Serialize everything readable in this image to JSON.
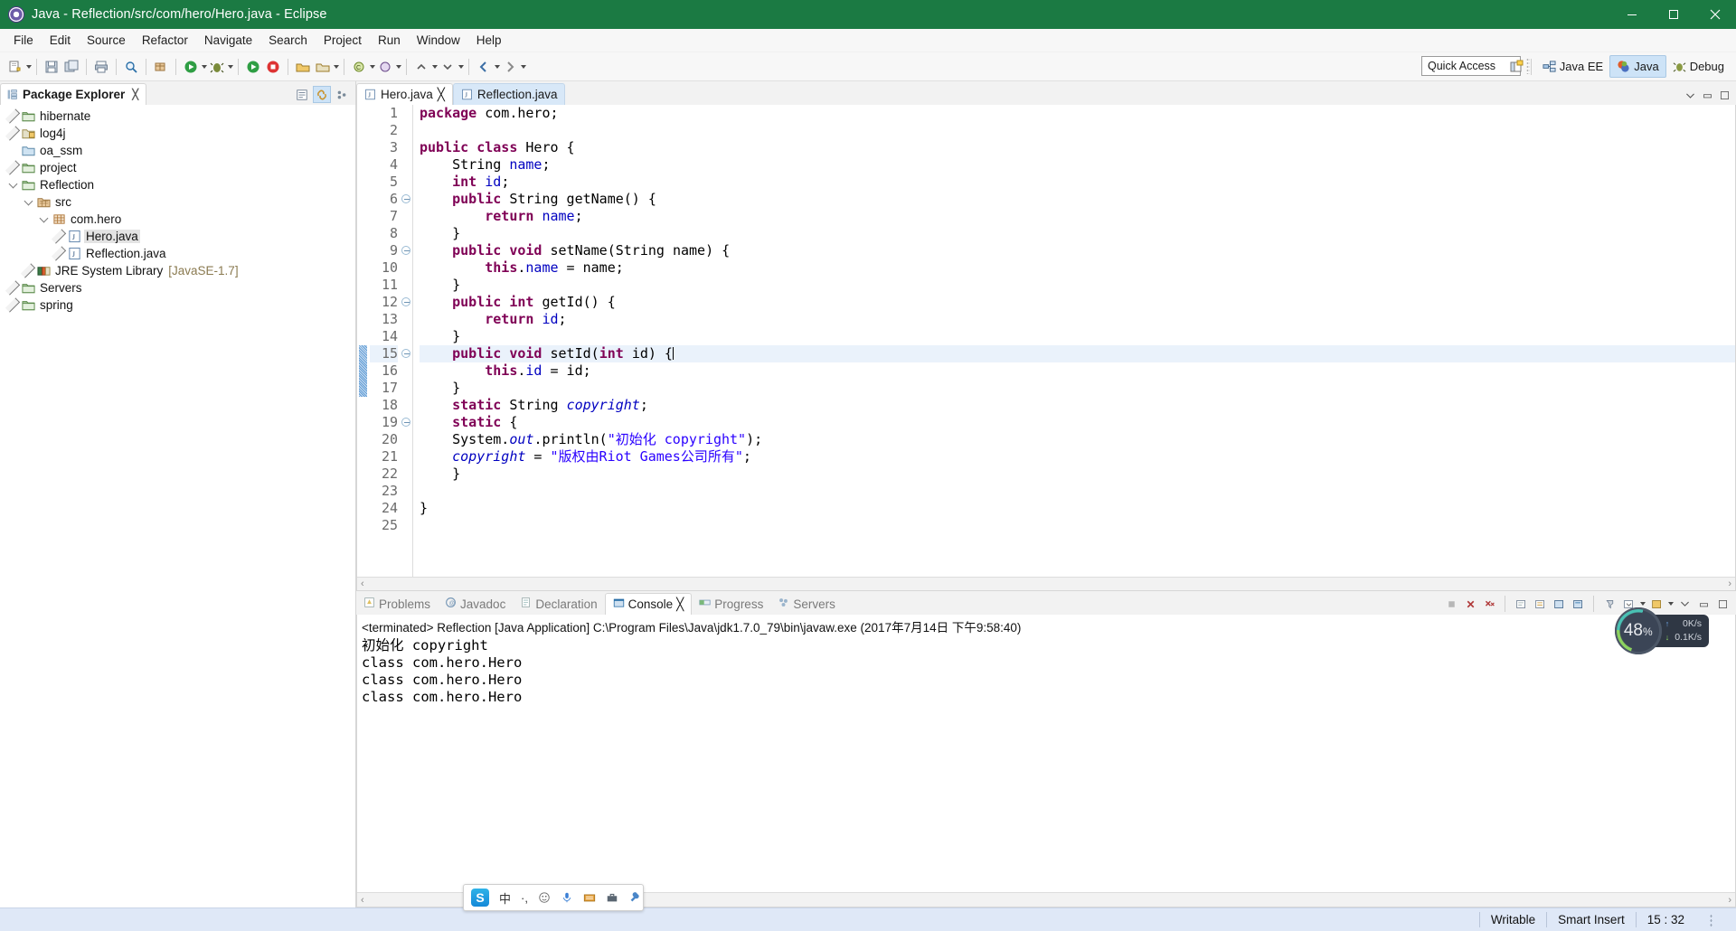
{
  "window": {
    "title": "Java - Reflection/src/com/hero/Hero.java - Eclipse",
    "app_icon": "eclipse-icon",
    "minimize": "–",
    "maximize": "❐",
    "close": "✕"
  },
  "menubar": {
    "items": [
      "File",
      "Edit",
      "Source",
      "Refactor",
      "Navigate",
      "Search",
      "Project",
      "Run",
      "Window",
      "Help"
    ]
  },
  "toolbar": {
    "quick_access_placeholder": "Quick Access",
    "quick_access_value": "Quick Access",
    "perspectives": [
      {
        "label": "Java EE",
        "icon": "java-ee-perspective-icon",
        "active": false
      },
      {
        "label": "Java",
        "icon": "java-perspective-icon",
        "active": true
      },
      {
        "label": "Debug",
        "icon": "debug-perspective-icon",
        "active": false
      }
    ],
    "open_perspective_icon": "open-perspective-icon"
  },
  "package_explorer": {
    "title": "Package Explorer",
    "close_glyph": "╳",
    "actions": [
      "collapse-all-icon",
      "link-with-editor-icon",
      "view-menu-icon"
    ],
    "tree": [
      {
        "label": "hibernate",
        "indent": 0,
        "twisty": "right",
        "icon": "project-folder-icon",
        "selected": false,
        "suffix": ""
      },
      {
        "label": "log4j",
        "indent": 0,
        "twisty": "right",
        "icon": "project-closed-icon",
        "selected": false,
        "suffix": ""
      },
      {
        "label": "oa_ssm",
        "indent": 0,
        "twisty": "none",
        "icon": "plain-folder-icon",
        "selected": false,
        "suffix": ""
      },
      {
        "label": "project",
        "indent": 0,
        "twisty": "right",
        "icon": "project-folder-icon",
        "selected": false,
        "suffix": ""
      },
      {
        "label": "Reflection",
        "indent": 0,
        "twisty": "down",
        "icon": "project-folder-icon",
        "selected": false,
        "suffix": ""
      },
      {
        "label": "src",
        "indent": 1,
        "twisty": "down",
        "icon": "source-folder-icon",
        "selected": false,
        "suffix": ""
      },
      {
        "label": "com.hero",
        "indent": 2,
        "twisty": "down",
        "icon": "package-icon",
        "selected": false,
        "suffix": ""
      },
      {
        "label": "Hero.java",
        "indent": 3,
        "twisty": "right",
        "icon": "java-file-icon",
        "selected": true,
        "suffix": ""
      },
      {
        "label": "Reflection.java",
        "indent": 3,
        "twisty": "right",
        "icon": "java-file-icon",
        "selected": false,
        "suffix": ""
      },
      {
        "label": "JRE System Library",
        "indent": 1,
        "twisty": "right",
        "icon": "jre-library-icon",
        "selected": false,
        "suffix": "[JavaSE-1.7]"
      },
      {
        "label": "Servers",
        "indent": 0,
        "twisty": "right",
        "icon": "project-folder-icon",
        "selected": false,
        "suffix": ""
      },
      {
        "label": "spring",
        "indent": 0,
        "twisty": "right",
        "icon": "project-folder-icon",
        "selected": false,
        "suffix": ""
      }
    ]
  },
  "editor": {
    "tabs": [
      {
        "label": "Hero.java",
        "icon": "java-file-icon",
        "active": true,
        "close_glyph": "╳"
      },
      {
        "label": "Reflection.java",
        "icon": "java-file-icon",
        "active": false,
        "close_glyph": ""
      }
    ],
    "highlight_line": 15,
    "fold_lines": [
      6,
      9,
      12,
      15,
      19
    ],
    "selection_bar_lines": [
      15,
      16,
      17
    ],
    "lines": [
      {
        "n": 1,
        "tokens": [
          {
            "t": "package ",
            "c": "kw"
          },
          {
            "t": "com.hero;",
            "c": ""
          }
        ]
      },
      {
        "n": 2,
        "tokens": []
      },
      {
        "n": 3,
        "tokens": [
          {
            "t": "public class ",
            "c": "kw"
          },
          {
            "t": "Hero {",
            "c": ""
          }
        ]
      },
      {
        "n": 4,
        "tokens": [
          {
            "t": "    String ",
            "c": ""
          },
          {
            "t": "name",
            "c": "fld"
          },
          {
            "t": ";",
            "c": ""
          }
        ]
      },
      {
        "n": 5,
        "tokens": [
          {
            "t": "    ",
            "c": ""
          },
          {
            "t": "int ",
            "c": "kw"
          },
          {
            "t": "id",
            "c": "fld"
          },
          {
            "t": ";",
            "c": ""
          }
        ]
      },
      {
        "n": 6,
        "tokens": [
          {
            "t": "    ",
            "c": ""
          },
          {
            "t": "public ",
            "c": "kw"
          },
          {
            "t": "String getName() {",
            "c": ""
          }
        ]
      },
      {
        "n": 7,
        "tokens": [
          {
            "t": "        ",
            "c": ""
          },
          {
            "t": "return ",
            "c": "kw"
          },
          {
            "t": "name",
            "c": "fld"
          },
          {
            "t": ";",
            "c": ""
          }
        ]
      },
      {
        "n": 8,
        "tokens": [
          {
            "t": "    }",
            "c": ""
          }
        ]
      },
      {
        "n": 9,
        "tokens": [
          {
            "t": "    ",
            "c": ""
          },
          {
            "t": "public void ",
            "c": "kw"
          },
          {
            "t": "setName(String name) {",
            "c": ""
          }
        ]
      },
      {
        "n": 10,
        "tokens": [
          {
            "t": "        ",
            "c": ""
          },
          {
            "t": "this",
            "c": "kw"
          },
          {
            "t": ".",
            "c": ""
          },
          {
            "t": "name",
            "c": "fld"
          },
          {
            "t": " = name;",
            "c": ""
          }
        ]
      },
      {
        "n": 11,
        "tokens": [
          {
            "t": "    }",
            "c": ""
          }
        ]
      },
      {
        "n": 12,
        "tokens": [
          {
            "t": "    ",
            "c": ""
          },
          {
            "t": "public int ",
            "c": "kw"
          },
          {
            "t": "getId() {",
            "c": ""
          }
        ]
      },
      {
        "n": 13,
        "tokens": [
          {
            "t": "        ",
            "c": ""
          },
          {
            "t": "return ",
            "c": "kw"
          },
          {
            "t": "id",
            "c": "fld"
          },
          {
            "t": ";",
            "c": ""
          }
        ]
      },
      {
        "n": 14,
        "tokens": [
          {
            "t": "    }",
            "c": ""
          }
        ]
      },
      {
        "n": 15,
        "tokens": [
          {
            "t": "    ",
            "c": ""
          },
          {
            "t": "public void ",
            "c": "kw"
          },
          {
            "t": "setId(",
            "c": ""
          },
          {
            "t": "int ",
            "c": "kw"
          },
          {
            "t": "id) {",
            "c": ""
          },
          {
            "t": "|",
            "c": "caret"
          }
        ]
      },
      {
        "n": 16,
        "tokens": [
          {
            "t": "        ",
            "c": ""
          },
          {
            "t": "this",
            "c": "kw"
          },
          {
            "t": ".",
            "c": ""
          },
          {
            "t": "id",
            "c": "fld"
          },
          {
            "t": " = id;",
            "c": ""
          }
        ]
      },
      {
        "n": 17,
        "tokens": [
          {
            "t": "    }",
            "c": ""
          }
        ]
      },
      {
        "n": 18,
        "tokens": [
          {
            "t": "    ",
            "c": ""
          },
          {
            "t": "static ",
            "c": "kw"
          },
          {
            "t": "String ",
            "c": ""
          },
          {
            "t": "copyright",
            "c": "sfld"
          },
          {
            "t": ";",
            "c": ""
          }
        ]
      },
      {
        "n": 19,
        "tokens": [
          {
            "t": "    ",
            "c": ""
          },
          {
            "t": "static ",
            "c": "kw"
          },
          {
            "t": "{",
            "c": ""
          }
        ]
      },
      {
        "n": 20,
        "tokens": [
          {
            "t": "    System.",
            "c": ""
          },
          {
            "t": "out",
            "c": "sfld"
          },
          {
            "t": ".println(",
            "c": ""
          },
          {
            "t": "\"初始化 copyright\"",
            "c": "str"
          },
          {
            "t": ");",
            "c": ""
          }
        ]
      },
      {
        "n": 21,
        "tokens": [
          {
            "t": "    ",
            "c": ""
          },
          {
            "t": "copyright",
            "c": "sfld"
          },
          {
            "t": " = ",
            "c": ""
          },
          {
            "t": "\"版权由Riot Games公司所有\"",
            "c": "str"
          },
          {
            "t": ";",
            "c": ""
          }
        ]
      },
      {
        "n": 22,
        "tokens": [
          {
            "t": "    }",
            "c": ""
          }
        ]
      },
      {
        "n": 23,
        "tokens": []
      },
      {
        "n": 24,
        "tokens": [
          {
            "t": "}",
            "c": ""
          }
        ]
      },
      {
        "n": 25,
        "tokens": []
      }
    ]
  },
  "bottom_panel": {
    "tabs": [
      {
        "label": "Problems",
        "icon": "problems-icon",
        "active": false,
        "close_glyph": ""
      },
      {
        "label": "Javadoc",
        "icon": "javadoc-icon",
        "active": false,
        "close_glyph": ""
      },
      {
        "label": "Declaration",
        "icon": "declaration-icon",
        "active": false,
        "close_glyph": ""
      },
      {
        "label": "Console",
        "icon": "console-icon",
        "active": true,
        "close_glyph": "╳"
      },
      {
        "label": "Progress",
        "icon": "progress-icon",
        "active": false,
        "close_glyph": ""
      },
      {
        "label": "Servers",
        "icon": "servers-icon",
        "active": false,
        "close_glyph": ""
      }
    ],
    "actions": [
      "terminate-icon",
      "remove-launch-icon",
      "remove-all-terminated-icon",
      "clear-console-icon",
      "scroll-lock-icon",
      "word-wrap-icon",
      "show-console-on-output-icon",
      "pin-console-icon",
      "display-selected-console-icon",
      "open-console-icon",
      "view-menu-icon",
      "minimize-icon",
      "maximize-icon"
    ],
    "console": {
      "header": "<terminated> Reflection [Java Application] C:\\Program Files\\Java\\jdk1.7.0_79\\bin\\javaw.exe (2017年7月14日 下午9:58:40)",
      "output": [
        "初始化 copyright",
        "class com.hero.Hero",
        "class com.hero.Hero",
        "class com.hero.Hero"
      ]
    }
  },
  "ime_bar": {
    "logo": "S",
    "items": [
      "中",
      "·,",
      "smiley-icon",
      "microphone-icon",
      "keyboard-icon",
      "toolbox-icon",
      "settings-icon"
    ]
  },
  "net_widget": {
    "percent": "48",
    "percent_unit": "%",
    "upload": "0K/s",
    "download": "0.1K/s",
    "up_arrow": "↑",
    "down_arrow": "↓"
  },
  "statusbar": {
    "writable": "Writable",
    "insert_mode": "Smart Insert",
    "cursor_position": "15 : 32"
  },
  "colors": {
    "title_bg": "#1b7a43",
    "keyword": "#7f0055",
    "field": "#0000c0",
    "string": "#2a00ff",
    "line_highlight": "#eaf2fb",
    "perspective_active": "#cde3f7",
    "statusbar_bg": "#dfe8f7"
  }
}
